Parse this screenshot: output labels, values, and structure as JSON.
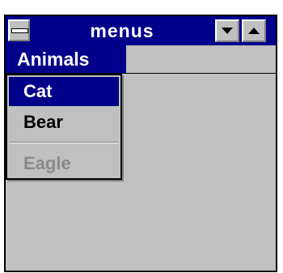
{
  "window": {
    "title": "menus",
    "system_menu_icon": "system-menu-icon",
    "minimize_icon": "minimize-arrow-icon",
    "maximize_icon": "maximize-arrow-icon"
  },
  "menubar": {
    "items": [
      {
        "label": "Animals",
        "open": true
      }
    ]
  },
  "dropdown": {
    "items": [
      {
        "label": "Cat",
        "selected": true,
        "enabled": true
      },
      {
        "label": "Bear",
        "selected": false,
        "enabled": true
      },
      {
        "label": "Eagle",
        "selected": false,
        "enabled": false
      }
    ]
  },
  "colors": {
    "titlebar": "#00008b",
    "chrome": "#c0c0c0",
    "highlight": "#00008b",
    "disabled_text": "#8a8a8a"
  }
}
